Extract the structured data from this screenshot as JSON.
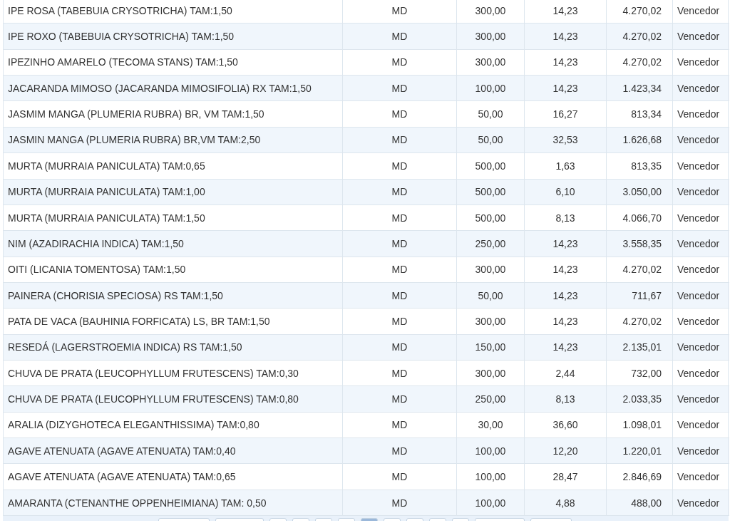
{
  "table": {
    "rows": [
      {
        "name": "IPE ROSA (TABEBUIA CRYSOTRICHA) TAM:1,50",
        "unit": "MD",
        "quantity": "300,00",
        "price": "14,23",
        "total": "4.270,02",
        "status": "Vencedor"
      },
      {
        "name": "IPE ROXO (TABEBUIA CRYSOTRICHA) TAM:1,50",
        "unit": "MD",
        "quantity": "300,00",
        "price": "14,23",
        "total": "4.270,02",
        "status": "Vencedor"
      },
      {
        "name": "IPEZINHO AMARELO (TECOMA STANS) TAM:1,50",
        "unit": "MD",
        "quantity": "300,00",
        "price": "14,23",
        "total": "4.270,02",
        "status": "Vencedor"
      },
      {
        "name": "JACARANDA MIMOSO (JACARANDA MIMOSIFOLIA) RX TAM:1,50",
        "unit": "MD",
        "quantity": "100,00",
        "price": "14,23",
        "total": "1.423,34",
        "status": "Vencedor"
      },
      {
        "name": "JASMIM MANGA (PLUMERIA RUBRA) BR, VM TAM:1,50",
        "unit": "MD",
        "quantity": "50,00",
        "price": "16,27",
        "total": "813,34",
        "status": "Vencedor"
      },
      {
        "name": "JASMIN MANGA (PLUMERIA RUBRA) BR,VM TAM:2,50",
        "unit": "MD",
        "quantity": "50,00",
        "price": "32,53",
        "total": "1.626,68",
        "status": "Vencedor"
      },
      {
        "name": "MURTA (MURRAIA PANICULATA) TAM:0,65",
        "unit": "MD",
        "quantity": "500,00",
        "price": "1,63",
        "total": "813,35",
        "status": "Vencedor"
      },
      {
        "name": "MURTA (MURRAIA PANICULATA) TAM:1,00",
        "unit": "MD",
        "quantity": "500,00",
        "price": "6,10",
        "total": "3.050,00",
        "status": "Vencedor"
      },
      {
        "name": "MURTA (MURRAIA PANICULATA) TAM:1,50",
        "unit": "MD",
        "quantity": "500,00",
        "price": "8,13",
        "total": "4.066,70",
        "status": "Vencedor"
      },
      {
        "name": "NIM (AZADIRACHIA INDICA) TAM:1,50",
        "unit": "MD",
        "quantity": "250,00",
        "price": "14,23",
        "total": "3.558,35",
        "status": "Vencedor"
      },
      {
        "name": "OITI (LICANIA TOMENTOSA) TAM:1,50",
        "unit": "MD",
        "quantity": "300,00",
        "price": "14,23",
        "total": "4.270,02",
        "status": "Vencedor"
      },
      {
        "name": "PAINERA (CHORISIA SPECIOSA) RS TAM:1,50",
        "unit": "MD",
        "quantity": "50,00",
        "price": "14,23",
        "total": "711,67",
        "status": "Vencedor"
      },
      {
        "name": "PATA DE VACA (BAUHINIA FORFICATA) LS, BR TAM:1,50",
        "unit": "MD",
        "quantity": "300,00",
        "price": "14,23",
        "total": "4.270,02",
        "status": "Vencedor"
      },
      {
        "name": "RESEDÁ (LAGERSTROEMIA INDICA) RS TAM:1,50",
        "unit": "MD",
        "quantity": "150,00",
        "price": "14,23",
        "total": "2.135,01",
        "status": "Vencedor"
      },
      {
        "name": "CHUVA DE PRATA (LEUCOPHYLLUM FRUTESCENS) TAM:0,30",
        "unit": "MD",
        "quantity": "300,00",
        "price": "2,44",
        "total": "732,00",
        "status": "Vencedor"
      },
      {
        "name": "CHUVA DE PRATA (LEUCOPHYLLUM FRUTESCENS) TAM:0,80",
        "unit": "MD",
        "quantity": "250,00",
        "price": "8,13",
        "total": "2.033,35",
        "status": "Vencedor"
      },
      {
        "name": "ARALIA (DIZYGHOTECA ELEGANTHISSIMA) TAM:0,80",
        "unit": "MD",
        "quantity": "30,00",
        "price": "36,60",
        "total": "1.098,01",
        "status": "Vencedor"
      },
      {
        "name": "AGAVE ATENUATA (AGAVE ATENUATA) TAM:0,40",
        "unit": "MD",
        "quantity": "100,00",
        "price": "12,20",
        "total": "1.220,01",
        "status": "Vencedor"
      },
      {
        "name": "AGAVE ATENUATA (AGAVE ATENUATA) TAM:0,65",
        "unit": "MD",
        "quantity": "100,00",
        "price": "28,47",
        "total": "2.846,69",
        "status": "Vencedor"
      },
      {
        "name": "AMARANTA (CTENANTHE OPPENHEIMIANA) TAM: 0,50",
        "unit": "MD",
        "quantity": "100,00",
        "price": "4,88",
        "total": "488,00",
        "status": "Vencedor"
      }
    ]
  },
  "pager": [
    {
      "kind": "wide",
      "selected": false
    },
    {
      "kind": "wide",
      "selected": false
    },
    {
      "kind": "page",
      "selected": false
    },
    {
      "kind": "page",
      "selected": false
    },
    {
      "kind": "page",
      "selected": false
    },
    {
      "kind": "page",
      "selected": false
    },
    {
      "kind": "page",
      "selected": true
    },
    {
      "kind": "page",
      "selected": false
    },
    {
      "kind": "page",
      "selected": false
    },
    {
      "kind": "page",
      "selected": false
    },
    {
      "kind": "page",
      "selected": false
    },
    {
      "kind": "wide",
      "selected": false
    },
    {
      "kind": "wide",
      "selected": false
    }
  ]
}
